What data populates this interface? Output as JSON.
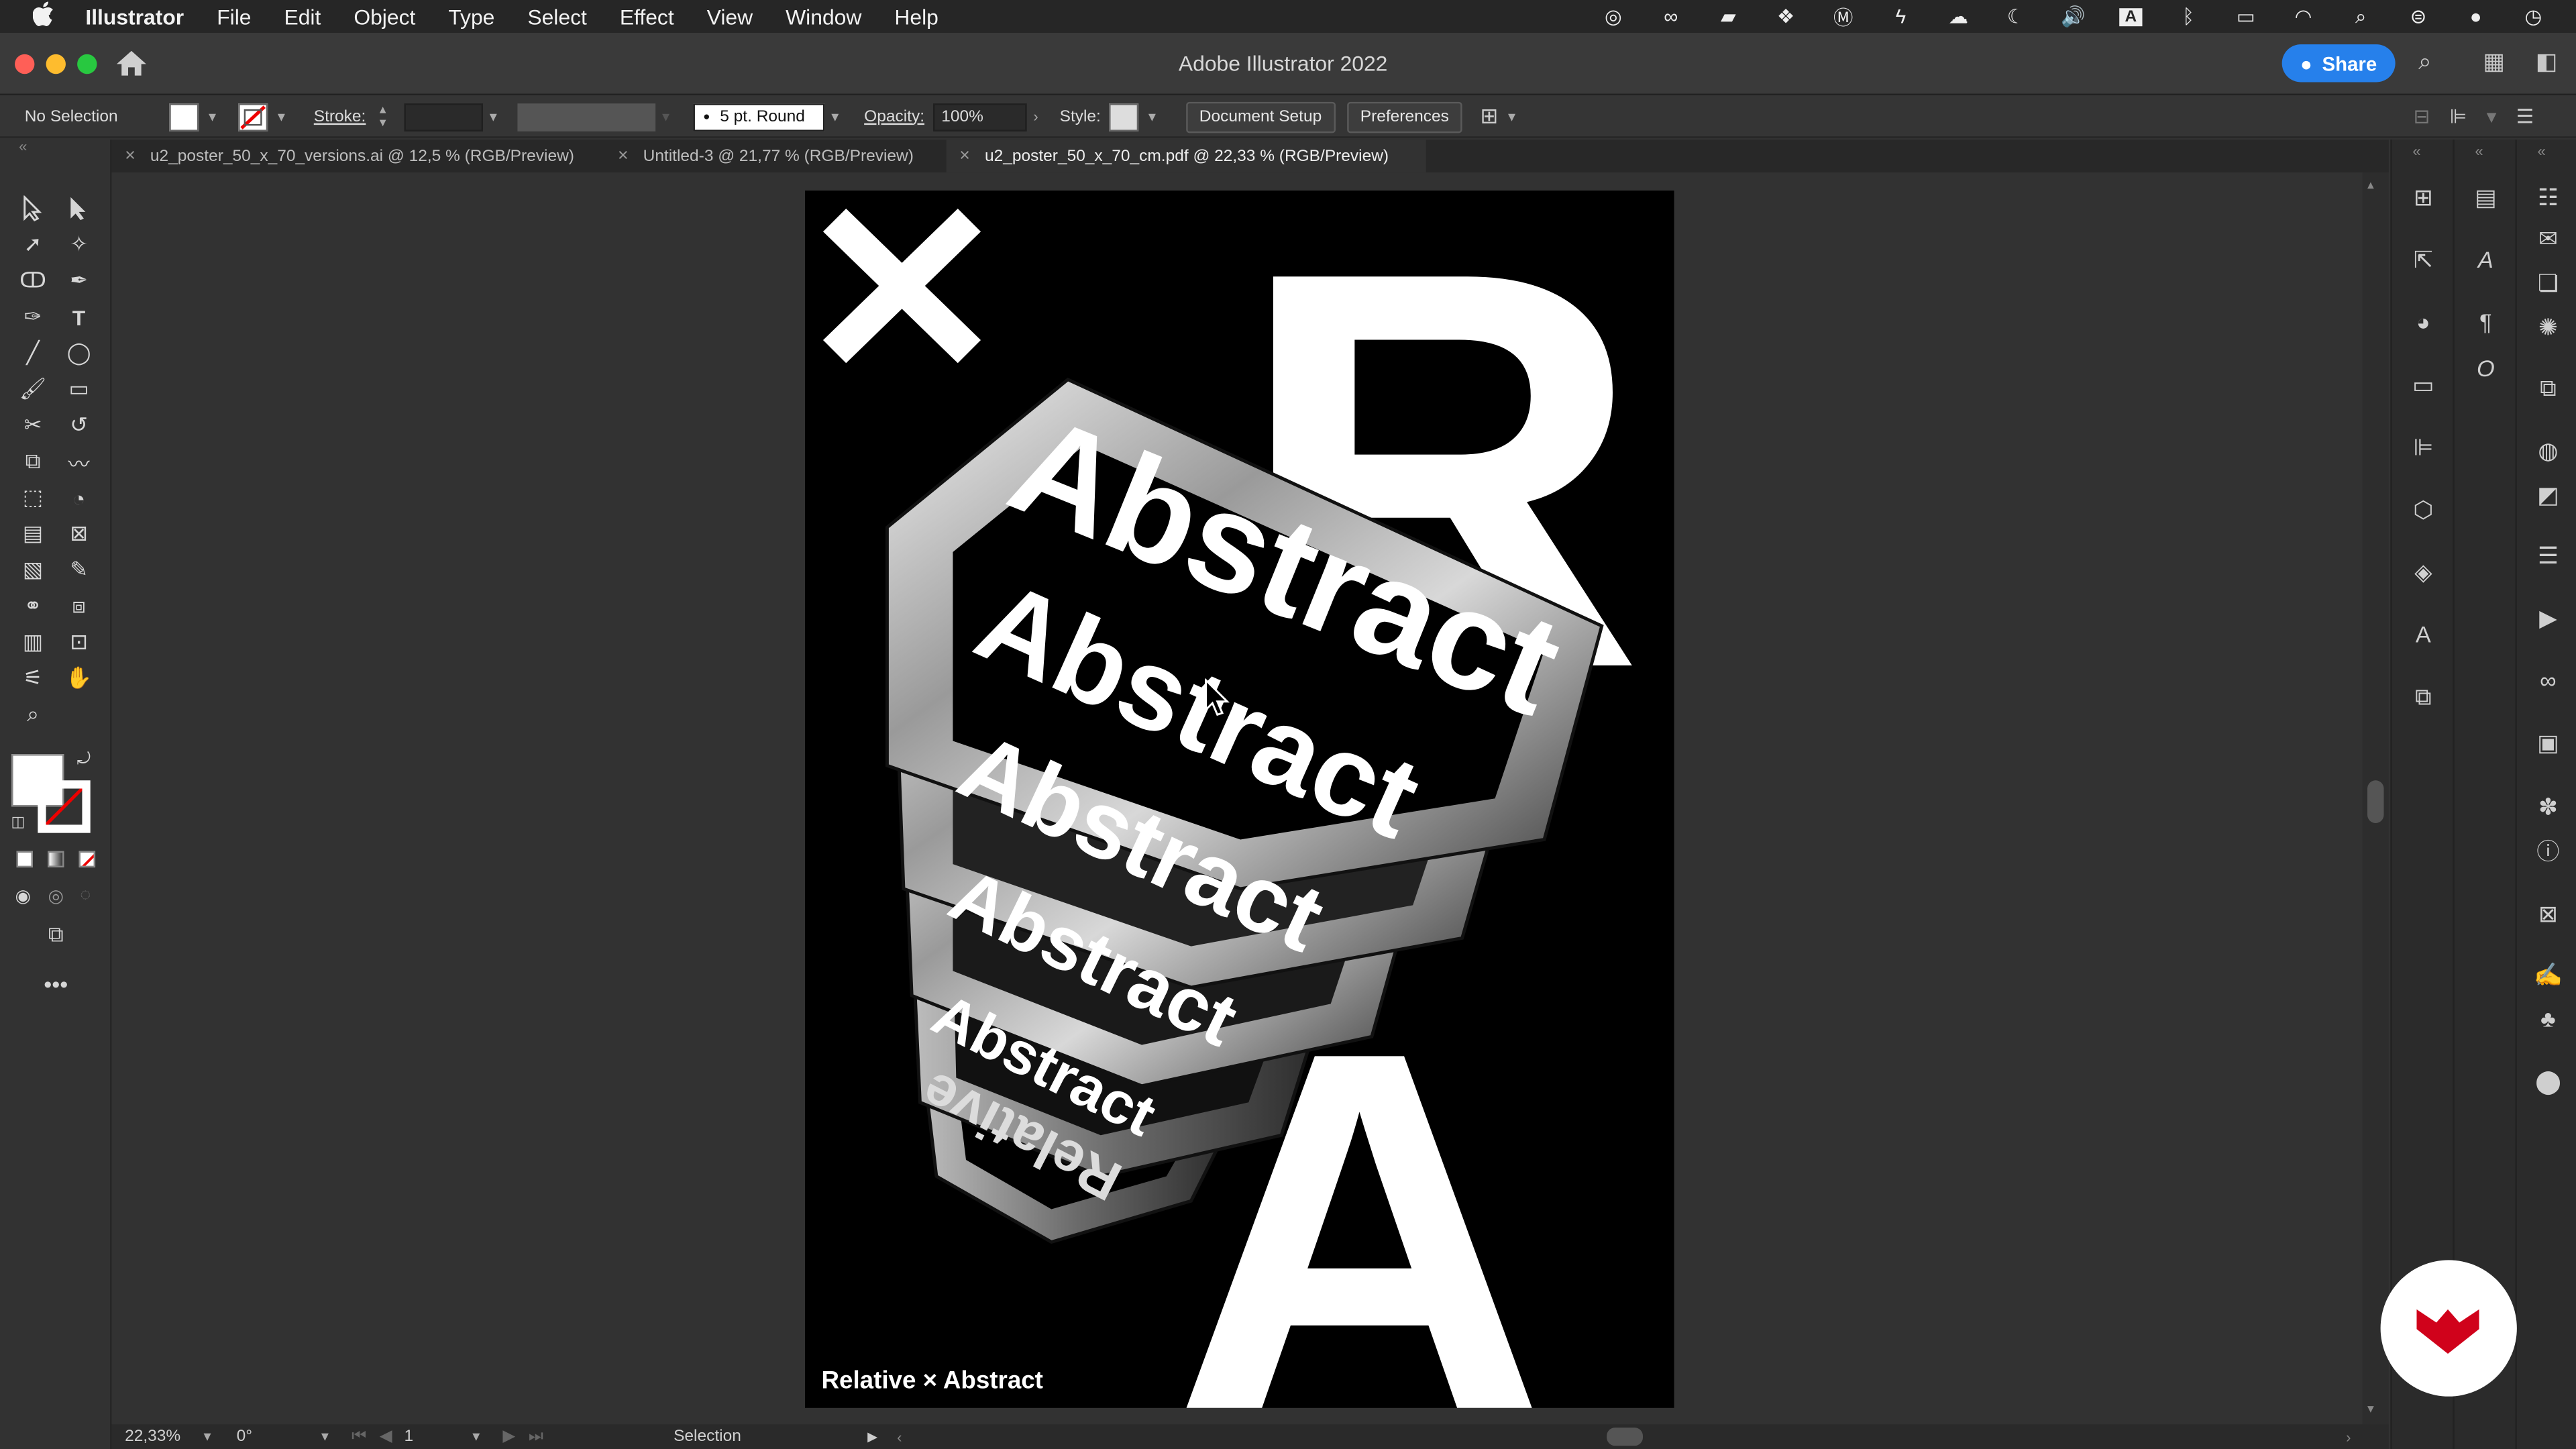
{
  "menubar": {
    "apple": "",
    "items": [
      "Illustrator",
      "File",
      "Edit",
      "Object",
      "Type",
      "Select",
      "Effect",
      "View",
      "Window",
      "Help"
    ]
  },
  "titlebar": {
    "title": "Adobe Illustrator 2022",
    "share": "Share"
  },
  "control": {
    "selection": "No Selection",
    "stroke_label": "Stroke:",
    "brush": "5 pt. Round",
    "opacity_label": "Opacity:",
    "opacity_value": "100%",
    "style_label": "Style:",
    "document_setup": "Document Setup",
    "preferences": "Preferences"
  },
  "tabs": [
    {
      "label": "u2_poster_50_x_70_versions.ai @ 12,5 % (RGB/Preview)",
      "active": false
    },
    {
      "label": "Untitled-3 @ 21,77 % (RGB/Preview)",
      "active": false
    },
    {
      "label": "u2_poster_50_x_70_cm.pdf @ 22,33 % (RGB/Preview)",
      "active": true
    }
  ],
  "artwork": {
    "x_mark": "×",
    "letter_r": "R",
    "letter_a": "A",
    "rings_word": "Abstract",
    "rings_word_mirror": "Relative",
    "caption": "Relative × Abstract"
  },
  "status": {
    "zoom": "22,33%",
    "rotation": "0°",
    "artboard": "1",
    "tool": "Selection"
  },
  "colors": {
    "accent": "#2680eb",
    "brand_badge": "#d0021b",
    "artboard": "#000000"
  }
}
